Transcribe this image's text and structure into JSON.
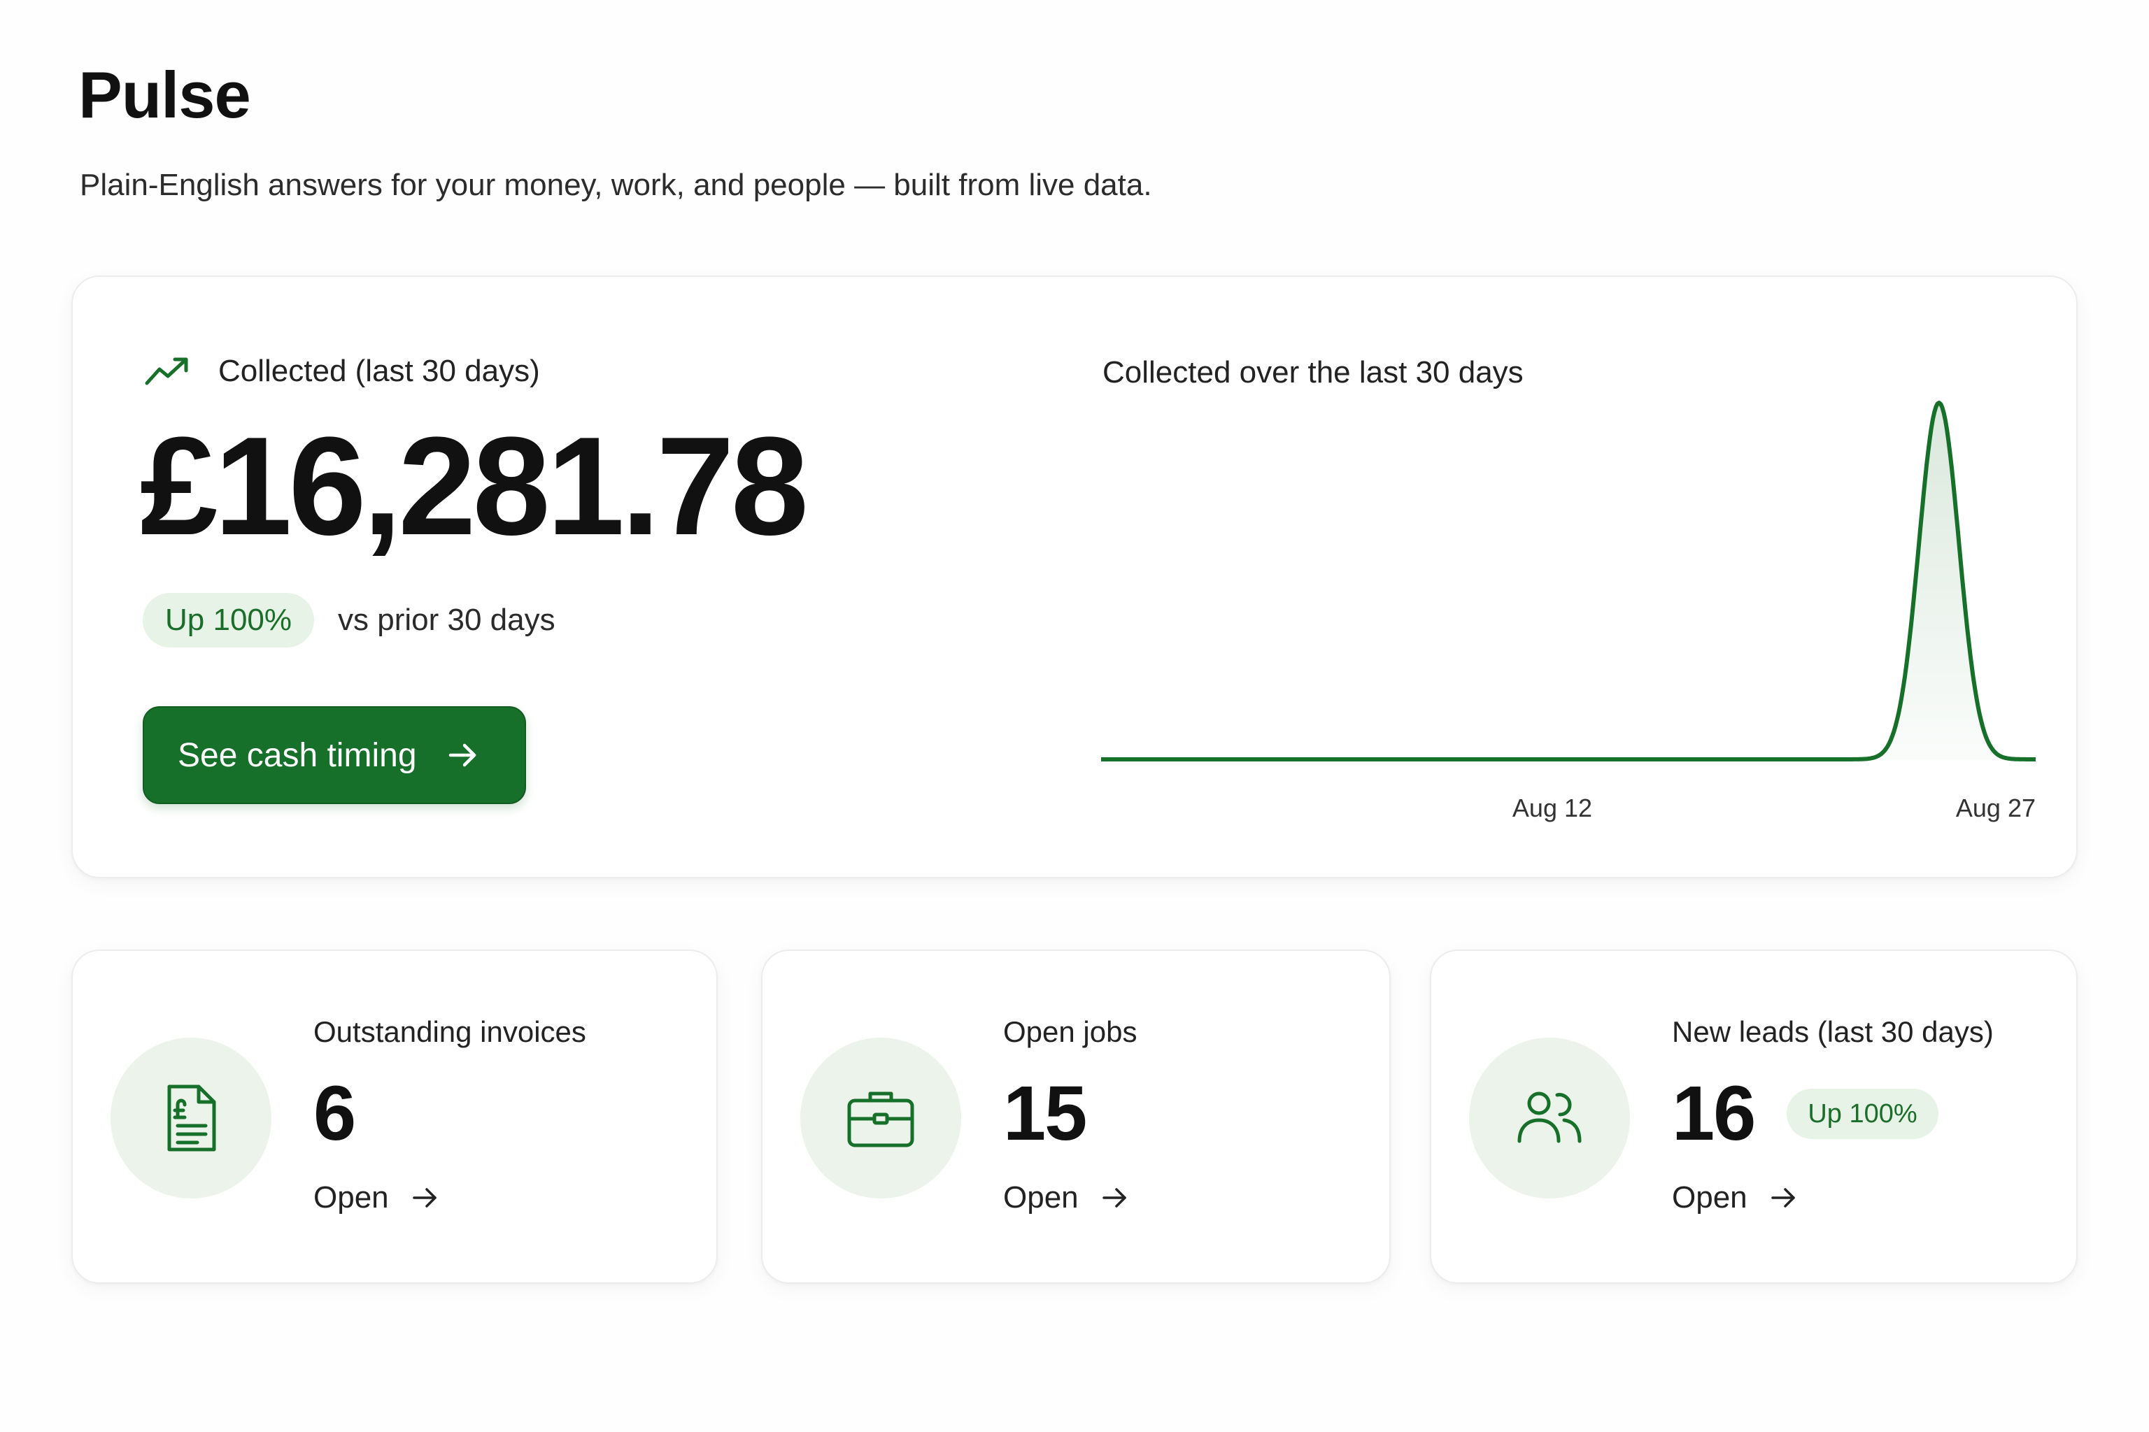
{
  "page": {
    "title": "Pulse",
    "subtitle": "Plain-English answers for your money, work, and people — built from live data."
  },
  "hero": {
    "metric_label": "Collected (last 30 days)",
    "value": "£16,281.78",
    "change_badge": "Up 100%",
    "change_compare": "vs prior 30 days",
    "cta_label": "See cash timing",
    "icons": {
      "trend": "trending-up-icon",
      "cta": "arrow-right-icon"
    }
  },
  "chart_data": {
    "type": "area",
    "title": "Collected over the last 30 days",
    "xlabel": "",
    "ylabel": "",
    "x_tick_labels": [
      "Aug 12",
      "Aug 27"
    ],
    "x": [
      "Jul 29",
      "Jul 30",
      "Jul 31",
      "Aug 1",
      "Aug 2",
      "Aug 3",
      "Aug 4",
      "Aug 5",
      "Aug 6",
      "Aug 7",
      "Aug 8",
      "Aug 9",
      "Aug 10",
      "Aug 11",
      "Aug 12",
      "Aug 13",
      "Aug 14",
      "Aug 15",
      "Aug 16",
      "Aug 17",
      "Aug 18",
      "Aug 19",
      "Aug 20",
      "Aug 21",
      "Aug 22",
      "Aug 23",
      "Aug 24",
      "Aug 25",
      "Aug 26",
      "Aug 27"
    ],
    "values": [
      0,
      0,
      0,
      0,
      0,
      0,
      0,
      0,
      0,
      0,
      0,
      0,
      0,
      0,
      0,
      0,
      0,
      0,
      0,
      0,
      0,
      0,
      0,
      0,
      0,
      0,
      16281.78,
      0,
      0,
      0
    ],
    "grid": false,
    "legend": "none",
    "line_color": "#17702a"
  },
  "metrics": [
    {
      "label": "Outstanding invoices",
      "value": "6",
      "badge": "",
      "link_label": "Open",
      "icon": "invoice-pound-icon"
    },
    {
      "label": "Open jobs",
      "value": "15",
      "badge": "",
      "link_label": "Open",
      "icon": "briefcase-icon"
    },
    {
      "label": "New leads (last 30 days)",
      "value": "16",
      "badge": "Up 100%",
      "link_label": "Open",
      "icon": "users-icon"
    }
  ],
  "colors": {
    "accent": "#17702a",
    "badge_bg": "#e8f3e8",
    "badge_text": "#1a6e2a",
    "icon_circle_bg": "#ebf3eb"
  }
}
